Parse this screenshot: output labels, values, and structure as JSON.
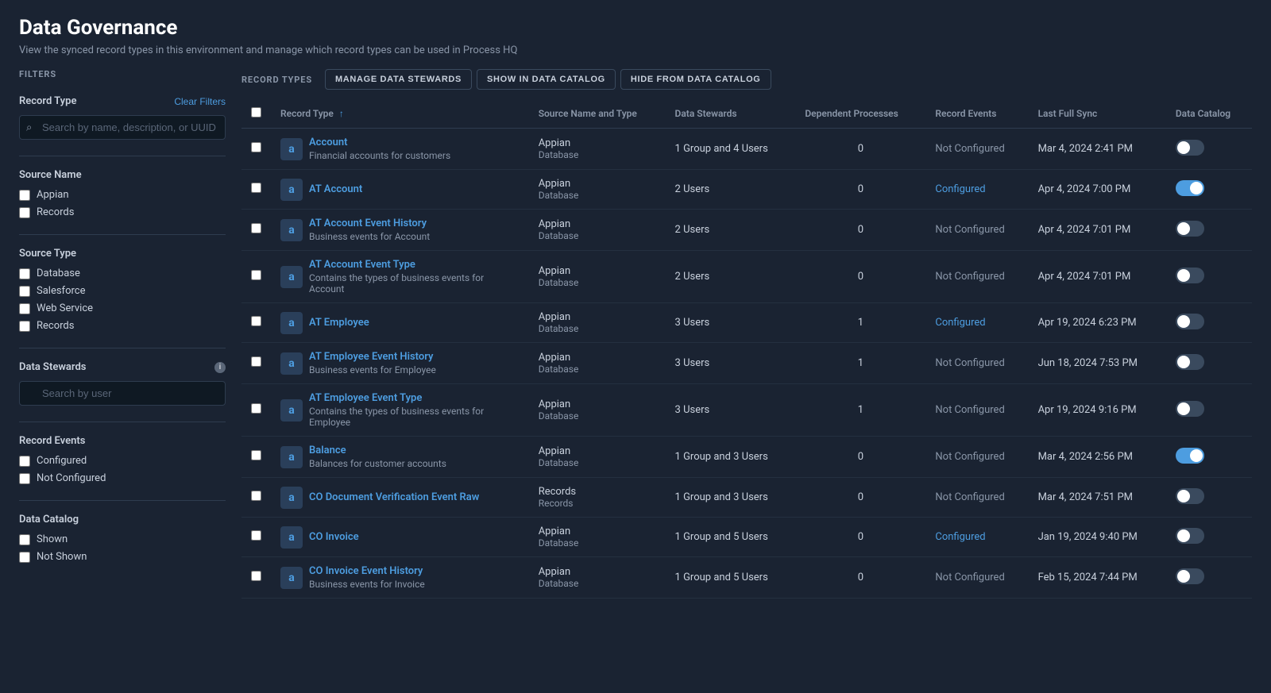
{
  "page": {
    "title": "Data Governance",
    "subtitle": "View the synced record types in this environment and manage which record types can be used in Process HQ"
  },
  "filters": {
    "section_label": "FILTERS",
    "record_type": {
      "label": "Record Type",
      "clear_label": "Clear Filters",
      "search_placeholder": "Search by name, description, or UUID"
    },
    "source_name": {
      "label": "Source Name",
      "options": [
        {
          "label": "Appian",
          "checked": false
        },
        {
          "label": "Records",
          "checked": false
        }
      ]
    },
    "source_type": {
      "label": "Source Type",
      "options": [
        {
          "label": "Database",
          "checked": false
        },
        {
          "label": "Salesforce",
          "checked": false
        },
        {
          "label": "Web Service",
          "checked": false
        },
        {
          "label": "Records",
          "checked": false
        }
      ]
    },
    "data_stewards": {
      "label": "Data Stewards",
      "search_placeholder": "Search by user"
    },
    "record_events": {
      "label": "Record Events",
      "options": [
        {
          "label": "Configured",
          "checked": false
        },
        {
          "label": "Not Configured",
          "checked": false
        }
      ]
    },
    "data_catalog": {
      "label": "Data Catalog",
      "options": [
        {
          "label": "Shown",
          "checked": false
        },
        {
          "label": "Not Shown",
          "checked": false
        }
      ]
    }
  },
  "main": {
    "section_label": "RECORD TYPES",
    "buttons": {
      "manage_stewards": "MANAGE DATA STEWARDS",
      "show_catalog": "SHOW IN DATA CATALOG",
      "hide_catalog": "HIDE FROM DATA CATALOG"
    },
    "table": {
      "columns": [
        {
          "label": "Record Type",
          "sortable": true
        },
        {
          "label": "Source Name and Type",
          "sortable": false
        },
        {
          "label": "Data Stewards",
          "sortable": false
        },
        {
          "label": "Dependent Processes",
          "sortable": false
        },
        {
          "label": "Record Events",
          "sortable": false
        },
        {
          "label": "Last Full Sync",
          "sortable": false
        },
        {
          "label": "Data Catalog",
          "sortable": false
        }
      ],
      "rows": [
        {
          "name": "Account",
          "description": "Financial accounts for customers",
          "source_name": "Appian",
          "source_type": "Database",
          "data_stewards": "1 Group and 4 Users",
          "dependent_processes": "0",
          "record_events": "Not Configured",
          "last_full_sync": "Mar 4, 2024 2:41 PM",
          "data_catalog_on": false
        },
        {
          "name": "AT Account",
          "description": "",
          "source_name": "Appian",
          "source_type": "Database",
          "data_stewards": "2 Users",
          "dependent_processes": "0",
          "record_events": "Configured",
          "last_full_sync": "Apr 4, 2024 7:00 PM",
          "data_catalog_on": true
        },
        {
          "name": "AT Account Event History",
          "description": "Business events for Account",
          "source_name": "Appian",
          "source_type": "Database",
          "data_stewards": "2 Users",
          "dependent_processes": "0",
          "record_events": "Not Configured",
          "last_full_sync": "Apr 4, 2024 7:01 PM",
          "data_catalog_on": false
        },
        {
          "name": "AT Account Event Type",
          "description": "Contains the types of business events for Account",
          "source_name": "Appian",
          "source_type": "Database",
          "data_stewards": "2 Users",
          "dependent_processes": "0",
          "record_events": "Not Configured",
          "last_full_sync": "Apr 4, 2024 7:01 PM",
          "data_catalog_on": false
        },
        {
          "name": "AT Employee",
          "description": "",
          "source_name": "Appian",
          "source_type": "Database",
          "data_stewards": "3 Users",
          "dependent_processes": "1",
          "record_events": "Configured",
          "last_full_sync": "Apr 19, 2024 6:23 PM",
          "data_catalog_on": false
        },
        {
          "name": "AT Employee Event History",
          "description": "Business events for Employee",
          "source_name": "Appian",
          "source_type": "Database",
          "data_stewards": "3 Users",
          "dependent_processes": "1",
          "record_events": "Not Configured",
          "last_full_sync": "Jun 18, 2024 7:53 PM",
          "data_catalog_on": false
        },
        {
          "name": "AT Employee Event Type",
          "description": "Contains the types of business events for Employee",
          "source_name": "Appian",
          "source_type": "Database",
          "data_stewards": "3 Users",
          "dependent_processes": "1",
          "record_events": "Not Configured",
          "last_full_sync": "Apr 19, 2024 9:16 PM",
          "data_catalog_on": false
        },
        {
          "name": "Balance",
          "description": "Balances for customer accounts",
          "source_name": "Appian",
          "source_type": "Database",
          "data_stewards": "1 Group and 3 Users",
          "dependent_processes": "0",
          "record_events": "Not Configured",
          "last_full_sync": "Mar 4, 2024 2:56 PM",
          "data_catalog_on": true
        },
        {
          "name": "CO Document Verification Event Raw",
          "description": "",
          "source_name": "Records",
          "source_type": "Records",
          "data_stewards": "1 Group and 3 Users",
          "dependent_processes": "0",
          "record_events": "Not Configured",
          "last_full_sync": "Mar 4, 2024 7:51 PM",
          "data_catalog_on": false
        },
        {
          "name": "CO Invoice",
          "description": "",
          "source_name": "Appian",
          "source_type": "Database",
          "data_stewards": "1 Group and 5 Users",
          "dependent_processes": "0",
          "record_events": "Configured",
          "last_full_sync": "Jan 19, 2024 9:40 PM",
          "data_catalog_on": false
        },
        {
          "name": "CO Invoice Event History",
          "description": "Business events for Invoice",
          "source_name": "Appian",
          "source_type": "Database",
          "data_stewards": "1 Group and 5 Users",
          "dependent_processes": "0",
          "record_events": "Not Configured",
          "last_full_sync": "Feb 15, 2024 7:44 PM",
          "data_catalog_on": false
        }
      ]
    }
  }
}
